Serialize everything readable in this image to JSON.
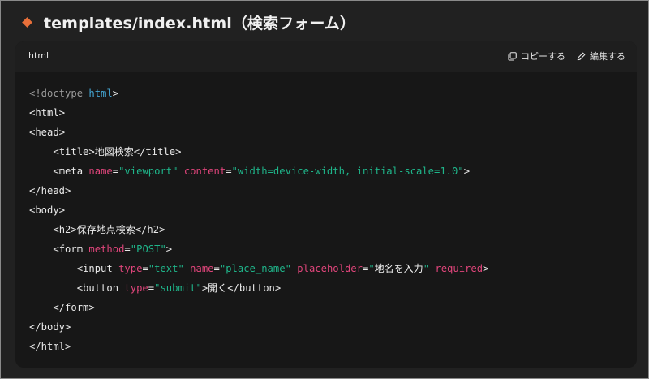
{
  "heading": {
    "title": "templates/index.html（検索フォーム）"
  },
  "code_block": {
    "language": "html",
    "copy_label": "コピーする",
    "edit_label": "編集する",
    "lines": [
      "<!doctype html>",
      "<html>",
      "<head>",
      "    <title>地図検索</title>",
      "    <meta name=\"viewport\" content=\"width=device-width, initial-scale=1.0\">",
      "</head>",
      "<body>",
      "    <h2>保存地点検索</h2>",
      "    <form method=\"POST\">",
      "        <input type=\"text\" name=\"place_name\" placeholder=\"地名を入力\" required>",
      "        <button type=\"submit\">開く</button>",
      "    </form>",
      "</body>",
      "</html>"
    ]
  },
  "colors": {
    "accent_diamond": "#e8703a",
    "keyword": "#45a8d6",
    "attribute": "#e0457b",
    "string": "#1fb58a",
    "doctype": "#9a9a9a"
  },
  "icons": {
    "heading": "diamond-bullet-icon",
    "copy": "copy-icon",
    "edit": "pencil-icon"
  }
}
